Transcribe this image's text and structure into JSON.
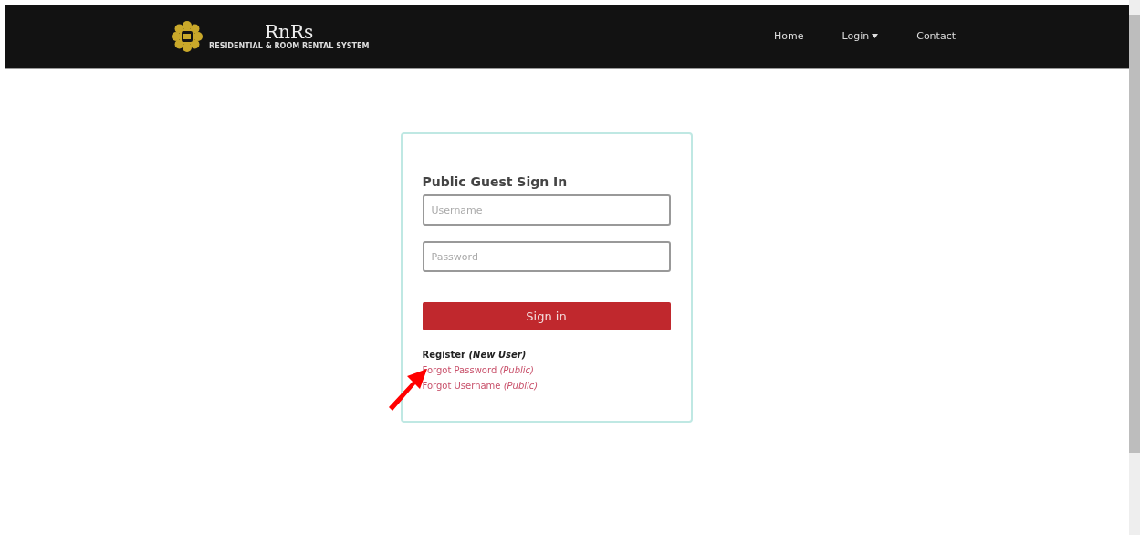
{
  "brand": {
    "name": "RnRs",
    "tagline": "RESIDENTIAL & ROOM RENTAL SYSTEM"
  },
  "nav": [
    {
      "label": "Home",
      "dropdown": false
    },
    {
      "label": "Login",
      "dropdown": true
    },
    {
      "label": "Contact",
      "dropdown": false
    }
  ],
  "signin": {
    "title": "Public Guest Sign In",
    "fields": [
      {
        "placeholder": "Username"
      },
      {
        "placeholder": "Password"
      }
    ],
    "button": "Sign in",
    "links": [
      {
        "text": "Register *(New User)*",
        "kind": "primary"
      },
      {
        "text": "Forgot Password *(Public)*",
        "kind": "secondary"
      },
      {
        "text": "Forgot Username *(Public)*",
        "kind": "secondary"
      }
    ]
  }
}
